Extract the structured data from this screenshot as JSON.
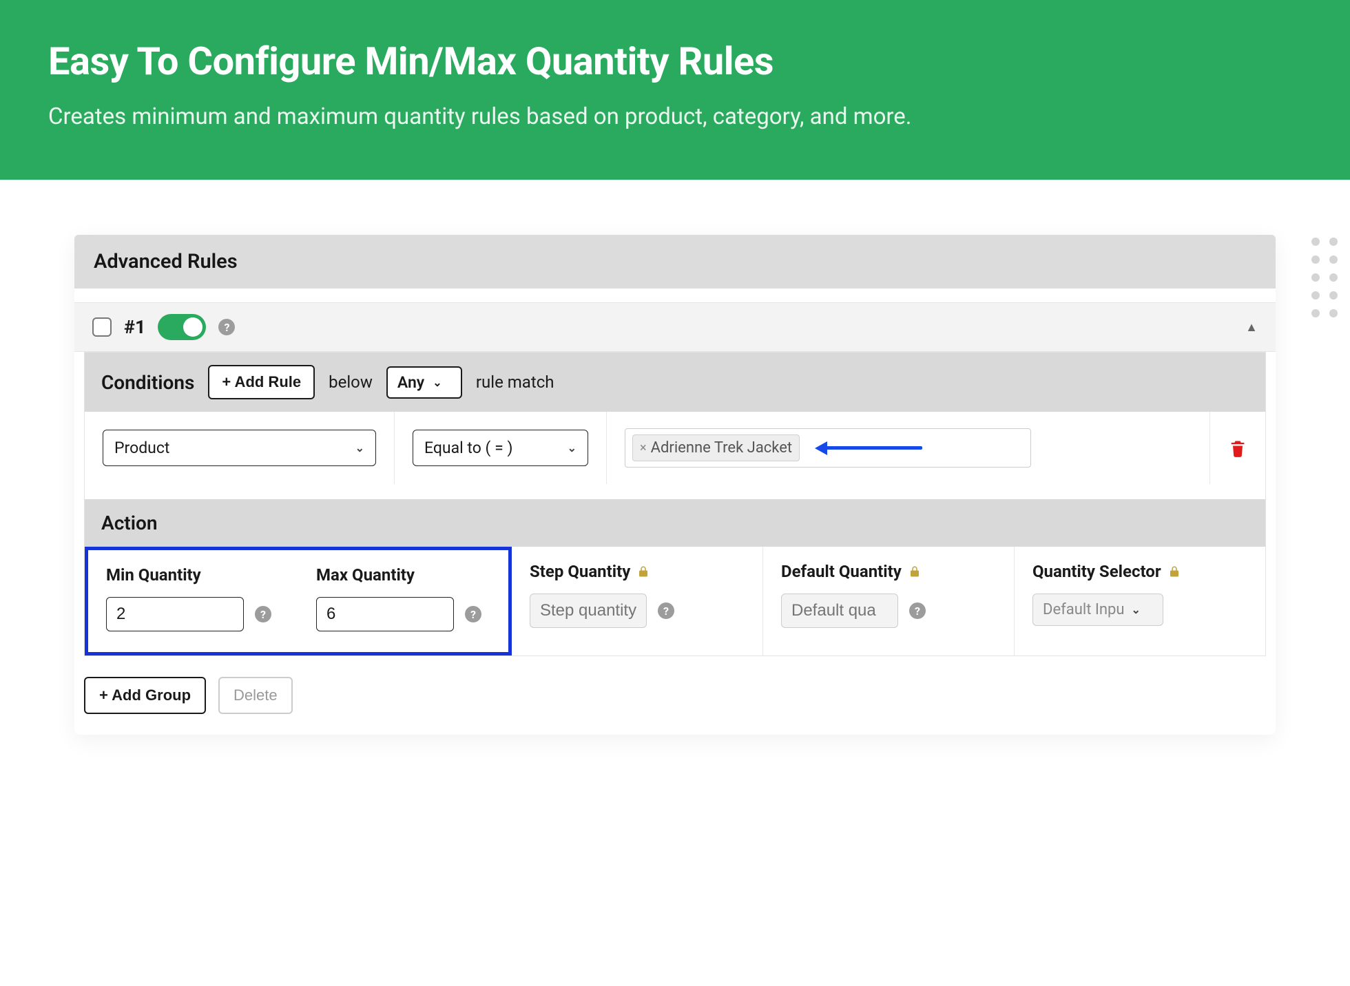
{
  "hero": {
    "title": "Easy To Configure Min/Max Quantity Rules",
    "subtitle": "Creates minimum and maximum quantity rules based on product, category, and more."
  },
  "panel": {
    "header": "Advanced Rules",
    "rule": {
      "number": "#1",
      "enabled": true
    },
    "conditions": {
      "title": "Conditions",
      "add_rule_label": "+ Add Rule",
      "below_label": "below",
      "match_mode": "Any",
      "rule_match_label": "rule match",
      "row": {
        "attribute": "Product",
        "operator": "Equal to ( = )",
        "value_tag": "Adrienne Trek Jacket"
      }
    },
    "action": {
      "title": "Action",
      "min": {
        "label": "Min Quantity",
        "value": "2"
      },
      "max": {
        "label": "Max Quantity",
        "value": "6"
      },
      "step": {
        "label": "Step Quantity",
        "placeholder": "Step quantity"
      },
      "default": {
        "label": "Default Quantity",
        "placeholder": "Default qua"
      },
      "selector": {
        "label": "Quantity Selector",
        "value": "Default Inpu"
      }
    },
    "footer": {
      "add_group_label": "+ Add Group",
      "delete_label": "Delete"
    }
  }
}
